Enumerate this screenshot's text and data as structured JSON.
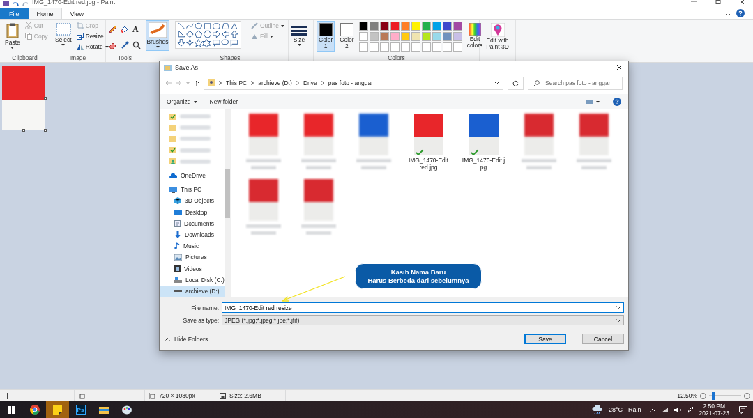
{
  "window": {
    "title": "IMG_1470-Edit red.jpg - Paint"
  },
  "ribbon_tabs": [
    {
      "label": "File",
      "kind": "file",
      "selected": false
    },
    {
      "label": "Home",
      "kind": "tab",
      "selected": true
    },
    {
      "label": "View",
      "kind": "tab",
      "selected": false
    }
  ],
  "clipboard": {
    "paste": "Paste",
    "cut": {
      "label": "Cut",
      "disabled": true
    },
    "copy": {
      "label": "Copy",
      "disabled": true
    },
    "group": "Clipboard"
  },
  "image": {
    "select": "Select",
    "crop": "Crop",
    "resize": "Resize",
    "rotate": "Rotate",
    "group": "Image"
  },
  "tools": {
    "text_tool": "A",
    "group": "Tools"
  },
  "brushes": {
    "label": "Brushes",
    "selected": true
  },
  "shapes": {
    "outline": "Outline",
    "fill": "Fill",
    "group": "Shapes"
  },
  "size": {
    "label": "Size"
  },
  "colors": {
    "group": "Colors",
    "slots": [
      {
        "label": "Color 1",
        "color": "#000000",
        "selected": true
      },
      {
        "label": "Color 2",
        "color": "#ffffff",
        "selected": false
      }
    ],
    "palette": [
      {
        "color": "#000000"
      },
      {
        "color": "#7f7f7f"
      },
      {
        "color": "#880015"
      },
      {
        "color": "#ed1c24"
      },
      {
        "color": "#ff7f27"
      },
      {
        "color": "#fff200"
      },
      {
        "color": "#22b14c"
      },
      {
        "color": "#00a2e8"
      },
      {
        "color": "#3f48cc"
      },
      {
        "color": "#a349a4"
      },
      {
        "color": "#ffffff"
      },
      {
        "color": "#c3c3c3"
      },
      {
        "color": "#b97a57"
      },
      {
        "color": "#ffaec9"
      },
      {
        "color": "#ffc90e"
      },
      {
        "color": "#efe4b0"
      },
      {
        "color": "#b5e61d"
      },
      {
        "color": "#99d9ea"
      },
      {
        "color": "#7092be"
      },
      {
        "color": "#c8bfe7"
      }
    ],
    "edit_colors": "Edit colors"
  },
  "paint3d": {
    "label": "Edit with Paint 3D"
  },
  "dialog": {
    "title": "Save As",
    "breadcrumb": [
      "This PC",
      "archieve (D:)",
      "Drive",
      "pas foto - anggar"
    ],
    "search": {
      "placeholder": "Search pas foto - anggar"
    },
    "toolbar": {
      "organize": "Organize",
      "new_folder": "New folder"
    },
    "nav": [
      {
        "kind": "blurred"
      },
      {
        "kind": "blurred"
      },
      {
        "kind": "blurred"
      },
      {
        "kind": "blurred"
      },
      {
        "kind": "blurred"
      },
      {
        "kind": "item",
        "label": "OneDrive",
        "selected": false
      },
      {
        "kind": "item",
        "label": "This PC",
        "selected": false,
        "children": [
          {
            "kind": "item",
            "label": "3D Objects",
            "selected": false
          },
          {
            "kind": "item",
            "label": "Desktop",
            "selected": false
          },
          {
            "kind": "item",
            "label": "Documents",
            "selected": false
          },
          {
            "kind": "item",
            "label": "Downloads",
            "selected": false
          },
          {
            "kind": "item",
            "label": "Music",
            "selected": false
          },
          {
            "kind": "item",
            "label": "Pictures",
            "selected": false
          },
          {
            "kind": "item",
            "label": "Videos",
            "selected": false
          },
          {
            "kind": "item",
            "label": "Local Disk (C:)",
            "selected": false
          },
          {
            "kind": "item",
            "label": "archieve (D:)",
            "selected": true
          }
        ]
      }
    ],
    "files": [
      {
        "kind": "blurred",
        "color": "#e8262a"
      },
      {
        "kind": "blurred",
        "color": "#e8262a"
      },
      {
        "kind": "blurred",
        "color": "#1a5fd0"
      },
      {
        "kind": "file",
        "name": "IMG_1470-Edit red.jpg",
        "color": "#e8262a"
      },
      {
        "kind": "file",
        "name": "IMG_1470-Edit.jpg",
        "color": "#1a5fd0"
      },
      {
        "kind": "blurred",
        "color": "#d82a30"
      },
      {
        "kind": "blurred",
        "color": "#d82a30"
      },
      {
        "kind": "blurred",
        "color": "#d82a30"
      },
      {
        "kind": "blurred",
        "color": "#d82a30"
      }
    ],
    "file_name": {
      "label": "File name:",
      "value": "IMG_1470-Edit red resize"
    },
    "save_type": {
      "label": "Save as type:",
      "value": "JPEG (*.jpg;*.jpeg;*.jpe;*.jfif)"
    },
    "hide_folders": "Hide Folders",
    "save": "Save",
    "cancel": "Cancel"
  },
  "callout": {
    "lines": [
      "Kasih Nama Baru",
      "Harus Berbeda dari sebelumnya"
    ]
  },
  "status_bar": {
    "dimensions": "720 × 1080px",
    "size": "Size: 2.6MB",
    "zoom": "12.50%",
    "level": 0.1
  },
  "taskbar": {
    "temperature": "28°C",
    "weather": "Rain",
    "time": "2:50 PM",
    "date": "2021-07-23",
    "apps": [
      {
        "kind": "chrome",
        "selected": false
      },
      {
        "kind": "notes",
        "selected": true
      },
      {
        "kind": "ps",
        "label": "Ps",
        "selected": false
      },
      {
        "kind": "explorer",
        "selected": false
      },
      {
        "kind": "paint",
        "selected": false
      }
    ]
  }
}
